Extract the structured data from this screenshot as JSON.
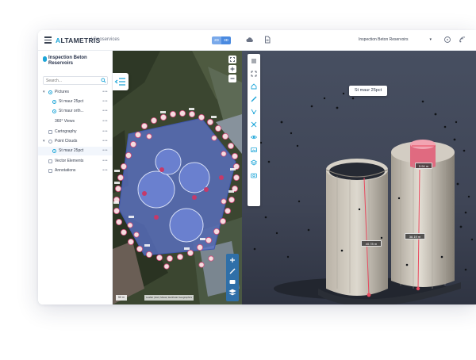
{
  "header": {
    "brand_prefix": "A",
    "brand_rest": "LTAMETRIS",
    "brand_sub": "/ Geoservices",
    "view_2d": "2D",
    "view_3d": "3D",
    "cloud_icon": "cloud-icon",
    "doc_icon": "document-icon",
    "project_selected": "Inspection Beton Reservoirs",
    "help_icon": "help-circle-icon",
    "signal_icon": "signal-icon"
  },
  "sidebar": {
    "project_title": "Inspection Beton Reservoirs",
    "search_placeholder": "Search...",
    "items": [
      {
        "label": "Pictures",
        "state": "group-on"
      },
      {
        "label": "St maur 25pct",
        "state": "on"
      },
      {
        "label": "St maur orth...",
        "state": "on"
      },
      {
        "label": "360° Views",
        "state": "off"
      },
      {
        "label": "Cartography",
        "state": "off"
      },
      {
        "label": "Point Clouds",
        "state": "group"
      },
      {
        "label": "St maur 25pct",
        "state": "on"
      },
      {
        "label": "Vector Elements",
        "state": "off"
      },
      {
        "label": "Annotations",
        "state": "off"
      }
    ],
    "more_label": "•••"
  },
  "map2d": {
    "scale_text": "50 m",
    "attribution": "Leaflet | Esri, Maxar, Earthstar Geographics"
  },
  "viewer3d": {
    "scene_title": "St maur 25pct",
    "measure_top": "5.94 m",
    "measure_left": "40.78 m",
    "measure_right": "38.19 m"
  },
  "colors": {
    "accent": "#1da5d8",
    "toggle_blue": "#4a8ae0",
    "measure_red": "#e84a5f",
    "marker_pink": "#f3d7da"
  }
}
